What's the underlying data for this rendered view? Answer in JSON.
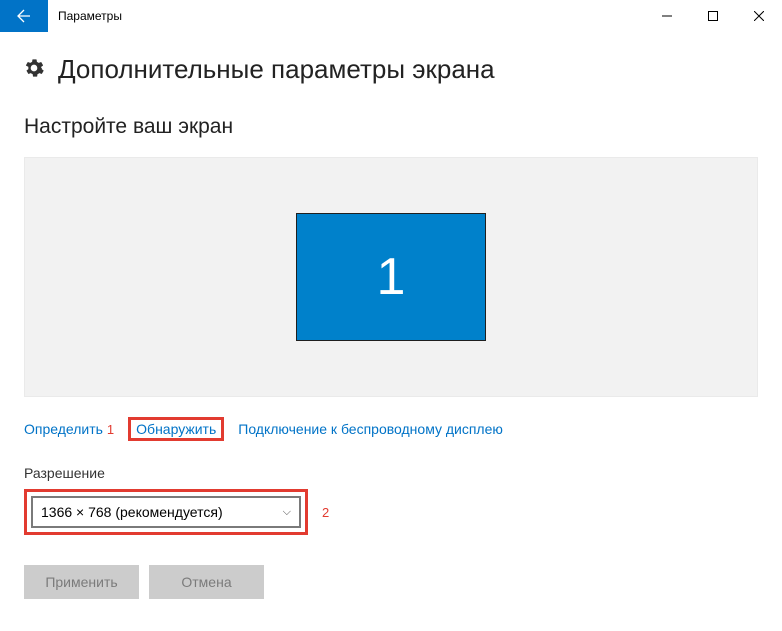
{
  "titlebar": {
    "title": "Параметры"
  },
  "page": {
    "title": "Дополнительные параметры экрана",
    "subheader": "Настройте ваш экран"
  },
  "monitor": {
    "number": "1"
  },
  "links": {
    "identify": "Определить",
    "detect": "Обнаружить",
    "wireless": "Подключение к беспроводному дисплею"
  },
  "annotations": {
    "n1": "1",
    "n2": "2"
  },
  "resolution": {
    "label": "Разрешение",
    "selected": "1366 × 768 (рекомендуется)"
  },
  "buttons": {
    "apply": "Применить",
    "cancel": "Отмена"
  }
}
